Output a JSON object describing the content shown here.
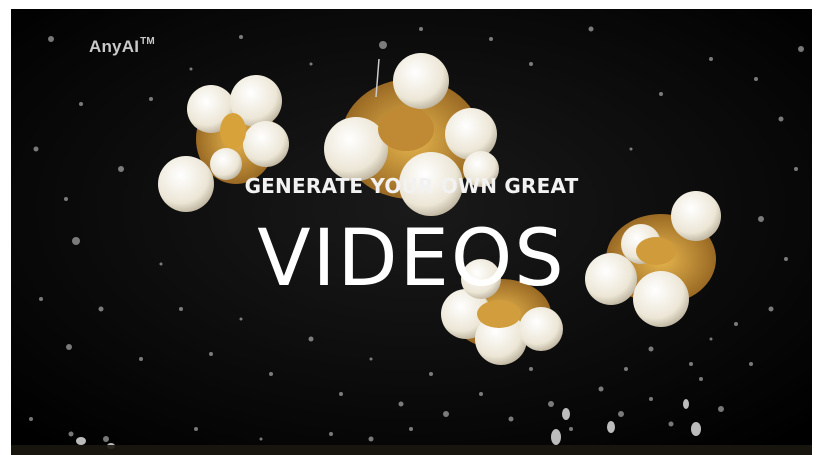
{
  "brand": {
    "name": "AnyAI",
    "trademark": "TM"
  },
  "hero": {
    "subtitle": "GENERATE YOUR OWN GREAT",
    "headline": "VIDEOS",
    "background": "popcorn-splash-video-frame"
  },
  "colors": {
    "background": "#030303",
    "text": "#ffffff",
    "popcorn": "#f1ece0",
    "kernel": "#c8952f"
  }
}
